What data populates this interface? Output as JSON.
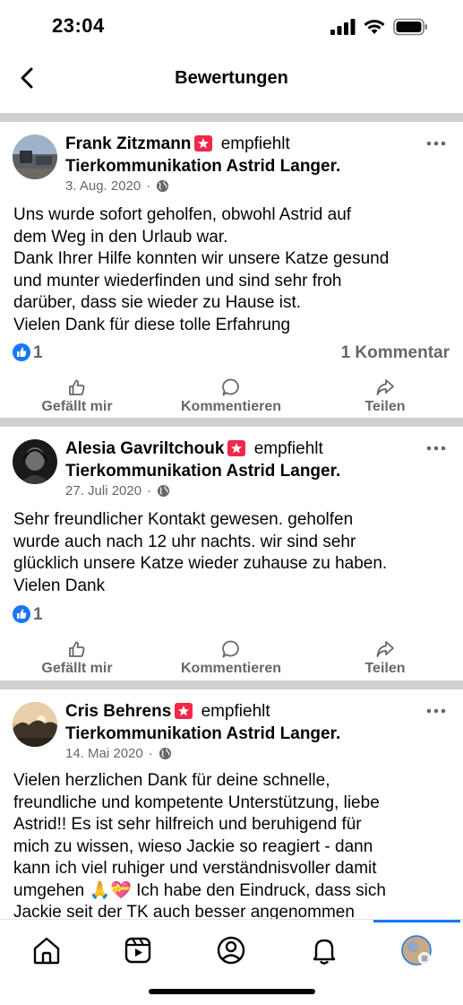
{
  "status_bar": {
    "time": "23:04",
    "icons": [
      "signal-icon",
      "wifi-icon",
      "battery-icon"
    ]
  },
  "nav": {
    "title": "Bewertungen",
    "back_icon": "chevron-left-icon"
  },
  "actions": {
    "like": "Gefällt mir",
    "comment": "Kommentieren",
    "share": "Teilen"
  },
  "recommends_word": "empfiehlt",
  "page_name": "Tierkommunikation Astrid Langer",
  "posts": [
    {
      "author": "Frank Zitzmann",
      "date": "3. Aug. 2020",
      "privacy": "globe-icon",
      "lines": [
        "Uns wurde sofort geholfen, obwohl Astrid auf",
        "dem Weg in den Urlaub war.",
        "Dank Ihrer Hilfe konnten wir unsere Katze gesund",
        "und munter wiederfinden und sind sehr froh",
        "darüber, dass sie wieder zu Hause ist.",
        "Vielen Dank für diese tolle Erfahrung"
      ],
      "likes": "1",
      "comments": "1 Kommentar"
    },
    {
      "author": "Alesia Gavriltchouk",
      "date": "27. Juli 2020",
      "privacy": "globe-icon",
      "lines": [
        "Sehr freundlicher Kontakt gewesen. geholfen",
        "wurde auch nach 12 uhr nachts. wir sind sehr",
        "glücklich unsere Katze wieder zuhause zu haben.",
        "Vielen Dank"
      ],
      "likes": "1",
      "comments": ""
    },
    {
      "author": "Cris Behrens",
      "date": "14. Mai 2020",
      "privacy": "globe-icon",
      "lines": [
        "Vielen herzlichen Dank für deine schnelle,",
        "freundliche und kompetente Unterstützung, liebe",
        "Astrid!! Es ist sehr hilfreich und beruhigend für",
        "mich zu wissen, wieso Jackie so reagiert - dann",
        "kann ich viel ruhiger und verständnisvoller damit",
        "umgehen 🙏💝 Ich habe den Eindruck, dass sich",
        "Jackie seit der TK auch besser angenommen"
      ],
      "likes": "",
      "comments": ""
    }
  ],
  "tabbar": [
    "home-icon",
    "video-icon",
    "profile-icon",
    "bell-icon",
    "menu-avatar"
  ],
  "colors": {
    "brand_blue": "#1877f2",
    "recommend_red": "#f02849",
    "secondary_text": "#65676b",
    "divider": "#ced0d4"
  }
}
